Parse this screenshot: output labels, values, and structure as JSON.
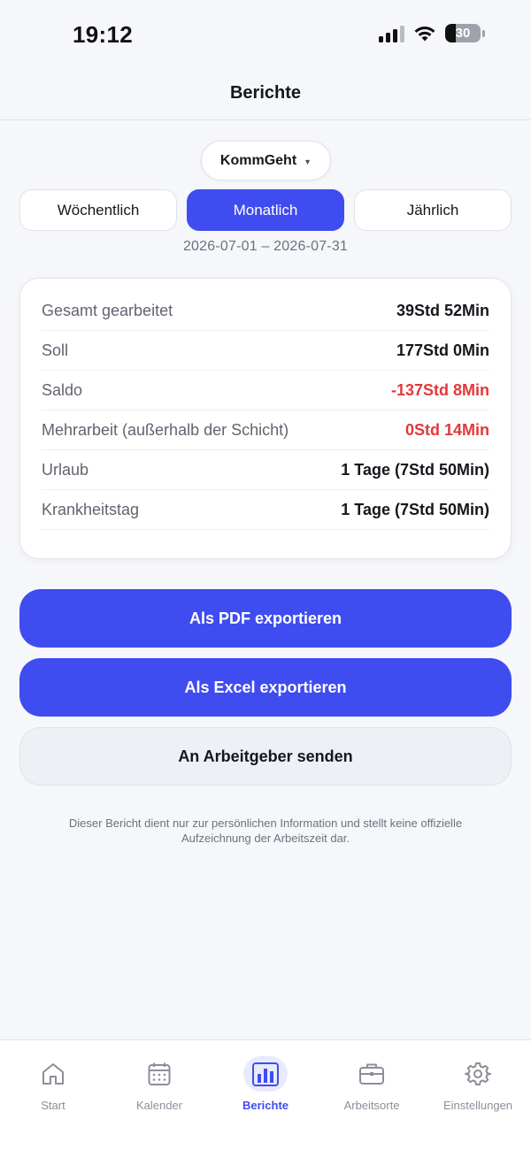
{
  "status_bar": {
    "time": "19:12",
    "battery": "30",
    "battery_level": 0.3
  },
  "header": {
    "title": "Berichte"
  },
  "profile_selector": {
    "label": "KommGeht"
  },
  "period_tabs": [
    {
      "label": "Wöchentlich",
      "active": false
    },
    {
      "label": "Monatlich",
      "active": true
    },
    {
      "label": "Jährlich",
      "active": false
    }
  ],
  "date_range": "2026-07-01 – 2026-07-31",
  "summary": [
    {
      "label": "Gesamt gearbeitet",
      "value": "39Std 52Min",
      "negative": false
    },
    {
      "label": "Soll",
      "value": "177Std 0Min",
      "negative": false
    },
    {
      "label": "Saldo",
      "value": "-137Std 8Min",
      "negative": true
    },
    {
      "label": "Mehrarbeit (außerhalb der Schicht)",
      "value": "0Std 14Min",
      "negative": true
    },
    {
      "label": "Urlaub",
      "value": "1 Tage (7Std 50Min)",
      "negative": false
    },
    {
      "label": "Krankheitstag",
      "value": "1 Tage (7Std 50Min)",
      "negative": false
    }
  ],
  "actions": {
    "pdf_label": "Als PDF exportieren",
    "excel_label": "Als Excel exportieren",
    "send_label": "An Arbeitgeber senden"
  },
  "disclaimer": "Dieser Bericht dient nur zur persönlichen Information und stellt keine offizielle Aufzeichnung der Arbeitszeit dar.",
  "tab_bar": [
    {
      "label": "Start",
      "icon": "home-icon",
      "active": false
    },
    {
      "label": "Kalender",
      "icon": "calendar-icon",
      "active": false
    },
    {
      "label": "Berichte",
      "icon": "bar-chart-icon",
      "active": true
    },
    {
      "label": "Arbeitsorte",
      "icon": "briefcase-icon",
      "active": false
    },
    {
      "label": "Einstellungen",
      "icon": "gear-icon",
      "active": false
    }
  ],
  "colors": {
    "accent": "#3f4cf0",
    "negative": "#e2383a",
    "background": "#f6f7fb"
  }
}
